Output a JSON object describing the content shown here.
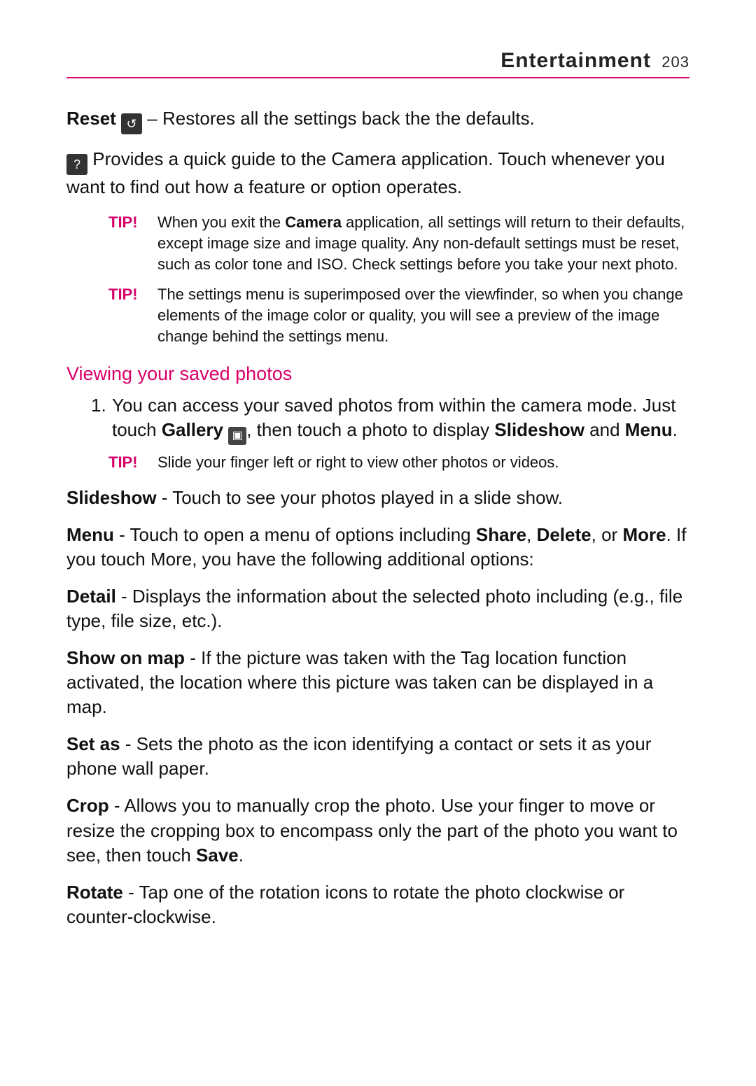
{
  "header": {
    "title": "Entertainment",
    "page": "203"
  },
  "reset": {
    "label": "Reset",
    "icon": "↺",
    "text": " – Restores all the settings back the the defaults."
  },
  "help": {
    "icon": "?",
    "text": "Provides a quick guide to the Camera application. Touch whenever you want to find out how a feature or option operates."
  },
  "tip1": {
    "label": "TIP!",
    "text_a": "When you exit the ",
    "bold": "Camera",
    "text_b": " application, all settings will return to their defaults, except image size and image quality. Any non-default settings must be reset, such as color tone and ISO. Check settings before you take your next photo."
  },
  "tip2": {
    "label": "TIP!",
    "text": "The settings menu is superimposed over the viewfinder, so when you change elements of the image color or quality, you will see a preview of the image change behind the settings menu."
  },
  "section": "Viewing your saved photos",
  "list1": {
    "num": "1.",
    "a": "You can access your saved photos from within the camera mode. Just touch ",
    "gallery_label": "Gallery",
    "gallery_icon": "▣",
    "b": ", then touch a photo to display ",
    "slideshow": "Slideshow",
    "and": " and ",
    "menu": "Menu",
    "period": "."
  },
  "tip3": {
    "label": "TIP!",
    "text": "Slide your finger left or right to view other photos or videos."
  },
  "slideshow": {
    "label": "Slideshow",
    "text": " - Touch to see your photos played in a slide show."
  },
  "menu": {
    "label": "Menu",
    "a": " - Touch to open a menu of options including ",
    "share": "Share",
    "comma": ", ",
    "delete": "Delete",
    "b": ", or ",
    "more": "More",
    "c": ". If you touch More, you have the following additional options:"
  },
  "detail": {
    "label": "Detail",
    "text": " - Displays the information about the selected photo including (e.g., file type, file size, etc.)."
  },
  "showonmap": {
    "label": "Show on map",
    "text": " - If the picture was taken with the Tag location function activated, the location where this picture was taken can be displayed in a map."
  },
  "setas": {
    "label": "Set as",
    "text": " - Sets the photo as the icon identifying a contact or sets it as your phone wall paper."
  },
  "crop": {
    "label": "Crop",
    "a": " - Allows you to manually crop the photo. Use your finger to move or resize the cropping box to encompass only the part of the photo you want to see, then touch ",
    "save": "Save",
    "b": "."
  },
  "rotate": {
    "label": "Rotate",
    "text": " - Tap one of the rotation icons to rotate the photo clockwise or counter-clockwise."
  }
}
